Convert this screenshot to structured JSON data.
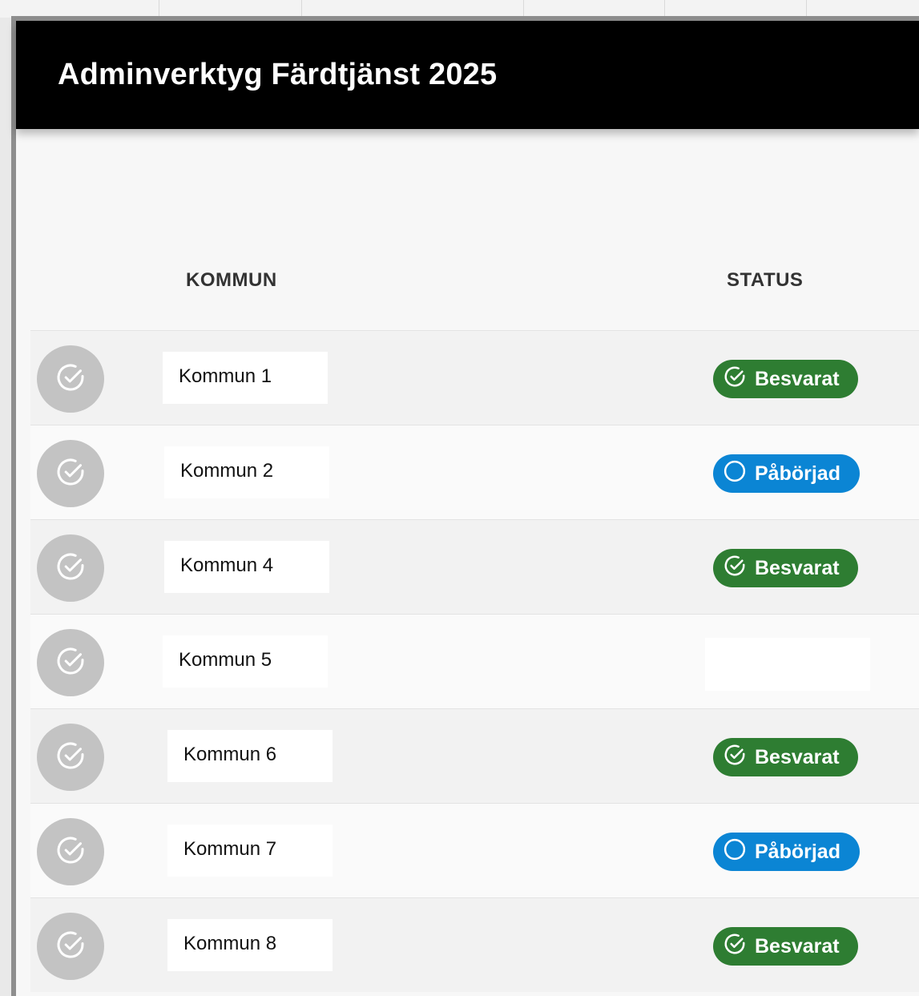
{
  "app": {
    "title": "Adminverktyg Färdtjänst 2025"
  },
  "table": {
    "headers": {
      "kommun": "KOMMUN",
      "status": "STATUS"
    },
    "rows": [
      {
        "name": "Kommun 1",
        "status": "Besvarat",
        "status_type": "answered"
      },
      {
        "name": "Kommun 2",
        "status": "Påbörjad",
        "status_type": "started"
      },
      {
        "name": "Kommun 4",
        "status": "Besvarat",
        "status_type": "answered"
      },
      {
        "name": "Kommun 5",
        "status": "",
        "status_type": "none"
      },
      {
        "name": "Kommun 6",
        "status": "Besvarat",
        "status_type": "answered"
      },
      {
        "name": "Kommun 7",
        "status": "Påbörjad",
        "status_type": "started"
      },
      {
        "name": "Kommun 8",
        "status": "Besvarat",
        "status_type": "answered"
      }
    ]
  },
  "icons": {
    "row_action": "check-circle-icon",
    "answered": "check-circle-icon",
    "started": "circle-outline-icon"
  },
  "colors": {
    "header_bg": "#000000",
    "answered": "#2e7d32",
    "started": "#0b85d4",
    "check_button": "#c3c3c3"
  }
}
